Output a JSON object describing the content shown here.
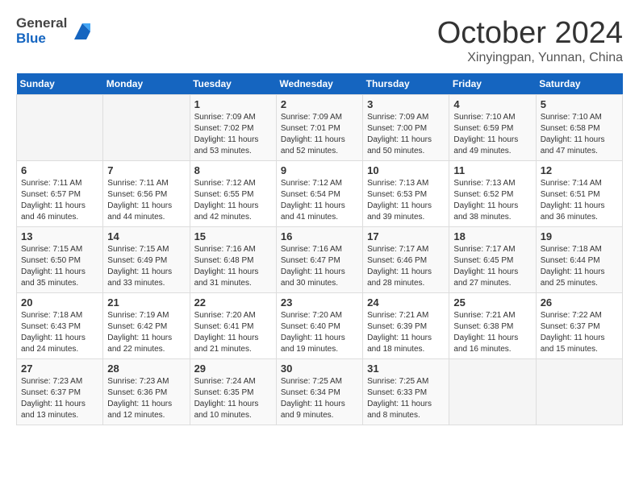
{
  "header": {
    "logo_line1": "General",
    "logo_line2": "Blue",
    "month": "October 2024",
    "location": "Xinyingpan, Yunnan, China"
  },
  "days_of_week": [
    "Sunday",
    "Monday",
    "Tuesday",
    "Wednesday",
    "Thursday",
    "Friday",
    "Saturday"
  ],
  "weeks": [
    [
      {
        "day": "",
        "info": ""
      },
      {
        "day": "",
        "info": ""
      },
      {
        "day": "1",
        "info": "Sunrise: 7:09 AM\nSunset: 7:02 PM\nDaylight: 11 hours and 53 minutes."
      },
      {
        "day": "2",
        "info": "Sunrise: 7:09 AM\nSunset: 7:01 PM\nDaylight: 11 hours and 52 minutes."
      },
      {
        "day": "3",
        "info": "Sunrise: 7:09 AM\nSunset: 7:00 PM\nDaylight: 11 hours and 50 minutes."
      },
      {
        "day": "4",
        "info": "Sunrise: 7:10 AM\nSunset: 6:59 PM\nDaylight: 11 hours and 49 minutes."
      },
      {
        "day": "5",
        "info": "Sunrise: 7:10 AM\nSunset: 6:58 PM\nDaylight: 11 hours and 47 minutes."
      }
    ],
    [
      {
        "day": "6",
        "info": "Sunrise: 7:11 AM\nSunset: 6:57 PM\nDaylight: 11 hours and 46 minutes."
      },
      {
        "day": "7",
        "info": "Sunrise: 7:11 AM\nSunset: 6:56 PM\nDaylight: 11 hours and 44 minutes."
      },
      {
        "day": "8",
        "info": "Sunrise: 7:12 AM\nSunset: 6:55 PM\nDaylight: 11 hours and 42 minutes."
      },
      {
        "day": "9",
        "info": "Sunrise: 7:12 AM\nSunset: 6:54 PM\nDaylight: 11 hours and 41 minutes."
      },
      {
        "day": "10",
        "info": "Sunrise: 7:13 AM\nSunset: 6:53 PM\nDaylight: 11 hours and 39 minutes."
      },
      {
        "day": "11",
        "info": "Sunrise: 7:13 AM\nSunset: 6:52 PM\nDaylight: 11 hours and 38 minutes."
      },
      {
        "day": "12",
        "info": "Sunrise: 7:14 AM\nSunset: 6:51 PM\nDaylight: 11 hours and 36 minutes."
      }
    ],
    [
      {
        "day": "13",
        "info": "Sunrise: 7:15 AM\nSunset: 6:50 PM\nDaylight: 11 hours and 35 minutes."
      },
      {
        "day": "14",
        "info": "Sunrise: 7:15 AM\nSunset: 6:49 PM\nDaylight: 11 hours and 33 minutes."
      },
      {
        "day": "15",
        "info": "Sunrise: 7:16 AM\nSunset: 6:48 PM\nDaylight: 11 hours and 31 minutes."
      },
      {
        "day": "16",
        "info": "Sunrise: 7:16 AM\nSunset: 6:47 PM\nDaylight: 11 hours and 30 minutes."
      },
      {
        "day": "17",
        "info": "Sunrise: 7:17 AM\nSunset: 6:46 PM\nDaylight: 11 hours and 28 minutes."
      },
      {
        "day": "18",
        "info": "Sunrise: 7:17 AM\nSunset: 6:45 PM\nDaylight: 11 hours and 27 minutes."
      },
      {
        "day": "19",
        "info": "Sunrise: 7:18 AM\nSunset: 6:44 PM\nDaylight: 11 hours and 25 minutes."
      }
    ],
    [
      {
        "day": "20",
        "info": "Sunrise: 7:18 AM\nSunset: 6:43 PM\nDaylight: 11 hours and 24 minutes."
      },
      {
        "day": "21",
        "info": "Sunrise: 7:19 AM\nSunset: 6:42 PM\nDaylight: 11 hours and 22 minutes."
      },
      {
        "day": "22",
        "info": "Sunrise: 7:20 AM\nSunset: 6:41 PM\nDaylight: 11 hours and 21 minutes."
      },
      {
        "day": "23",
        "info": "Sunrise: 7:20 AM\nSunset: 6:40 PM\nDaylight: 11 hours and 19 minutes."
      },
      {
        "day": "24",
        "info": "Sunrise: 7:21 AM\nSunset: 6:39 PM\nDaylight: 11 hours and 18 minutes."
      },
      {
        "day": "25",
        "info": "Sunrise: 7:21 AM\nSunset: 6:38 PM\nDaylight: 11 hours and 16 minutes."
      },
      {
        "day": "26",
        "info": "Sunrise: 7:22 AM\nSunset: 6:37 PM\nDaylight: 11 hours and 15 minutes."
      }
    ],
    [
      {
        "day": "27",
        "info": "Sunrise: 7:23 AM\nSunset: 6:37 PM\nDaylight: 11 hours and 13 minutes."
      },
      {
        "day": "28",
        "info": "Sunrise: 7:23 AM\nSunset: 6:36 PM\nDaylight: 11 hours and 12 minutes."
      },
      {
        "day": "29",
        "info": "Sunrise: 7:24 AM\nSunset: 6:35 PM\nDaylight: 11 hours and 10 minutes."
      },
      {
        "day": "30",
        "info": "Sunrise: 7:25 AM\nSunset: 6:34 PM\nDaylight: 11 hours and 9 minutes."
      },
      {
        "day": "31",
        "info": "Sunrise: 7:25 AM\nSunset: 6:33 PM\nDaylight: 11 hours and 8 minutes."
      },
      {
        "day": "",
        "info": ""
      },
      {
        "day": "",
        "info": ""
      }
    ]
  ]
}
